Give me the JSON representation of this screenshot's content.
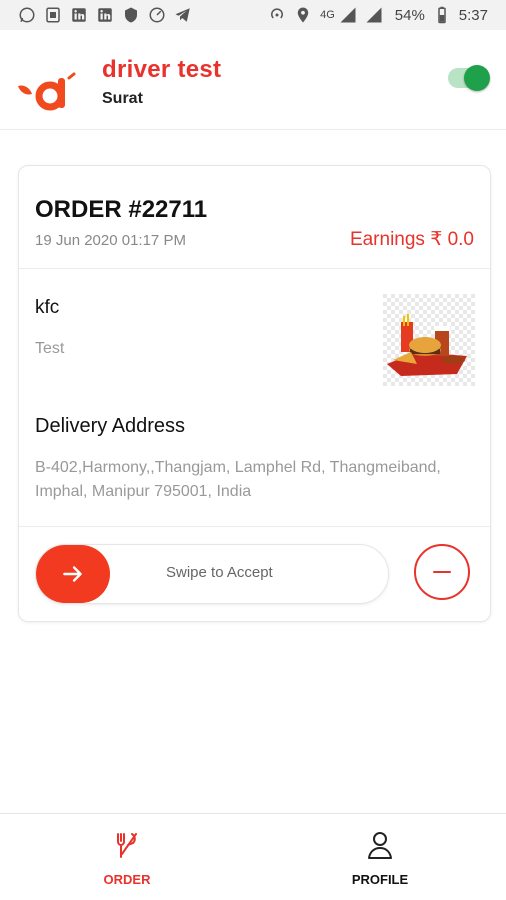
{
  "status_bar": {
    "network": "4G",
    "battery": "54%",
    "time": "5:37",
    "left_icons": [
      "whatsapp-icon",
      "sim-icon",
      "linkedin-icon",
      "linkedin-icon",
      "shield-icon",
      "speedometer-icon",
      "telegram-icon"
    ],
    "right_icons": [
      "hotspot-icon",
      "location-icon",
      "signal-icon",
      "signal-icon",
      "battery-icon"
    ]
  },
  "header": {
    "driver_name": "driver test",
    "city": "Surat",
    "online_toggle": true
  },
  "order": {
    "title": "ORDER #22711",
    "date": "19 Jun 2020 01:17 PM",
    "earnings": "Earnings ₹ 0.0",
    "restaurant": "kfc",
    "note": "Test",
    "delivery_heading": "Delivery Address",
    "address": "B-402,Harmony,,Thangjam, Lamphel Rd, Thangmeiband, Imphal, Manipur 795001, India",
    "swipe_label": "Swipe to Accept"
  },
  "bottom_nav": {
    "items": [
      {
        "label": "ORDER",
        "icon": "fork-knife-icon",
        "active": true
      },
      {
        "label": "PROFILE",
        "icon": "user-icon",
        "active": false
      }
    ]
  },
  "colors": {
    "accent": "#e8322b",
    "swipe": "#f13a1f",
    "toggle_on": "#1fa04a"
  }
}
